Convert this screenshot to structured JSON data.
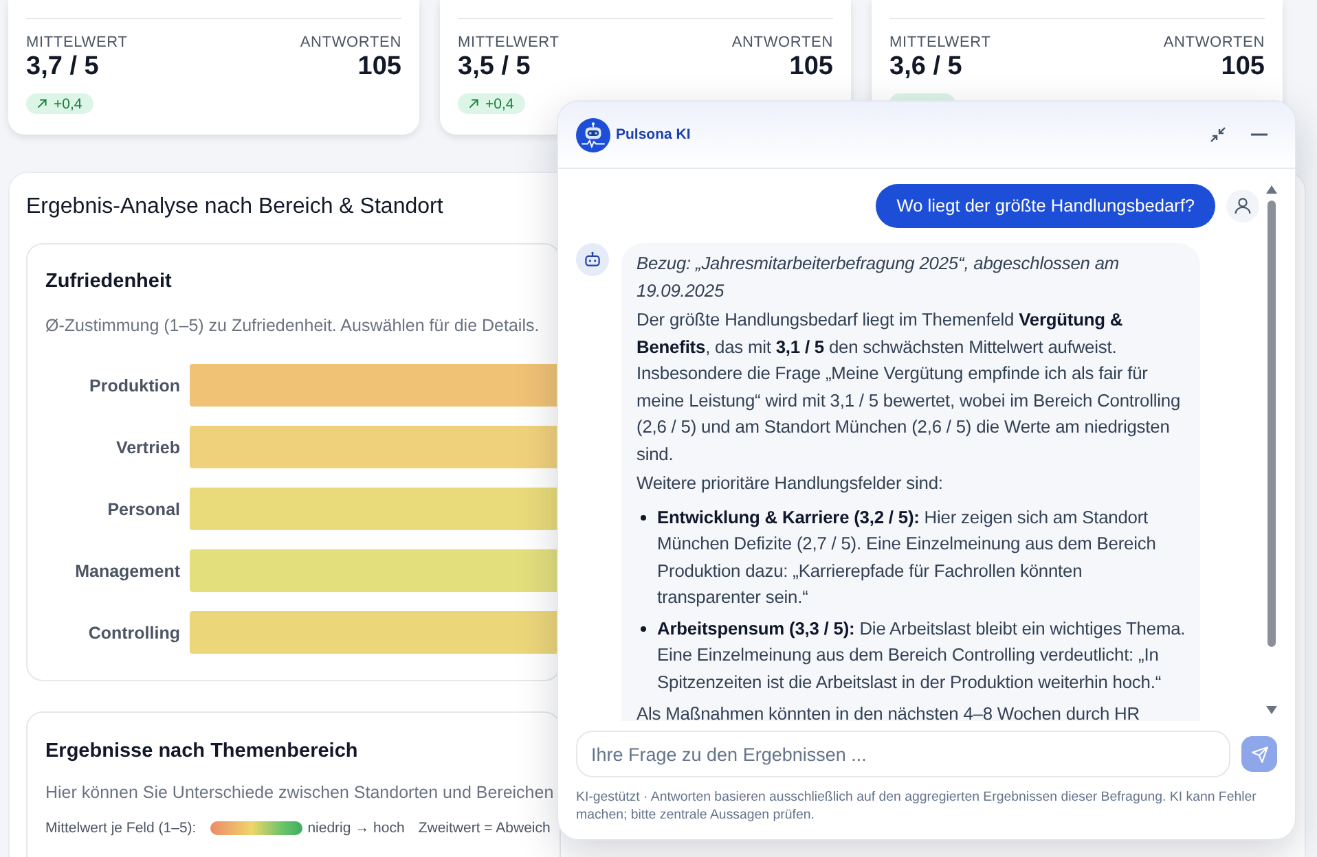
{
  "kpi_cards": [
    {
      "mean_label": "MITTELWERT",
      "mean": "3,7 / 5",
      "responses_label": "ANTWORTEN",
      "responses": "105",
      "rising": true,
      "change": "+0,4"
    },
    {
      "mean_label": "MITTELWERT",
      "mean": "3,5 / 5",
      "responses_label": "ANTWORTEN",
      "responses": "105",
      "rising": true,
      "change": "+0,4"
    },
    {
      "mean_label": "MITTELWERT",
      "mean": "3,6 / 5",
      "responses_label": "ANTWORTEN",
      "responses": "105",
      "rising": true
    }
  ],
  "analysis": {
    "title": "Ergebnis-Analyse nach Bereich & Standort",
    "satisfaction": {
      "title": "Zufriedenheit",
      "subtitle": "Ø-Zustimmung (1–5) zu Zufriedenheit. Auswählen für die Details.",
      "bars": [
        {
          "label": "Produktion",
          "color": "#f0c275"
        },
        {
          "label": "Vertrieb",
          "color": "#f0d17b"
        },
        {
          "label": "Personal",
          "color": "#e9db7a"
        },
        {
          "label": "Management",
          "color": "#e3df7d"
        },
        {
          "label": "Controlling",
          "color": "#ecd67a"
        }
      ]
    },
    "topics": {
      "title": "Ergebnisse nach Themenbereich",
      "subtitle": "Hier können Sie Unterschiede zwischen Standorten und Bereichen",
      "legend_label": "Mittelwert je Feld (1–5):",
      "scale_text": "niedrig → hoch",
      "secondary_note": "Zweitwert = Abweich"
    }
  },
  "chat": {
    "title": "Pulsona KI",
    "messages": [
      {
        "kind": "user",
        "text": "Wo liegt der größte Handlungsbedarf?"
      },
      {
        "kind": "assistant",
        "blocks": [
          {
            "kind": "note",
            "text": "Bezug: „Jahresmitarbeiterbefragung 2025“, abgeschlossen am 19.09.2025"
          },
          {
            "kind": "paragraph",
            "text": "Der größte Handlungsbedarf liegt im Themenfeld **Vergütung & Benefits**, das mit **3,1 / 5** den schwächsten Mittelwert aufweist. Insbesondere die Frage „Meine Vergütung empfinde ich als fair für meine Leistung“ wird mit 3,1 / 5 bewertet, wobei im Bereich Controlling (2,6 / 5) und am Standort München (2,6 / 5) die Werte am niedrigsten sind."
          },
          {
            "kind": "paragraph",
            "text": "Weitere prioritäre Handlungsfelder sind:"
          },
          {
            "kind": "list",
            "items": [
              "**Entwicklung & Karriere (3,2 / 5):** Hier zeigen sich am Standort München Defizite (2,7 / 5). Eine Einzelmeinung aus dem Bereich Produktion dazu: „Karrierepfade für Fachrollen könnten transparenter sein.“",
              "**Arbeitspensum (3,3 / 5):** Die Arbeitslast bleibt ein wichtiges Thema. Eine Einzelmeinung aus dem Bereich Controlling verdeutlicht: „In Spitzenzeiten ist die Arbeitslast in der Produktion weiterhin hoch.“"
            ]
          },
          {
            "kind": "paragraph",
            "text": "Als Maßnahmen könnten in den nächsten 4–8 Wochen durch HR"
          }
        ]
      }
    ],
    "input": {
      "placeholder": "Ihre Frage zu den Ergebnissen ..."
    },
    "send_button": {
      "disabled": true
    },
    "disclaimer": "KI-gestützt · Antworten basieren ausschließlich auf den aggregierten Ergebnissen dieser Befragung. KI kann Fehler machen; bitte zentrale Aussagen prüfen."
  }
}
